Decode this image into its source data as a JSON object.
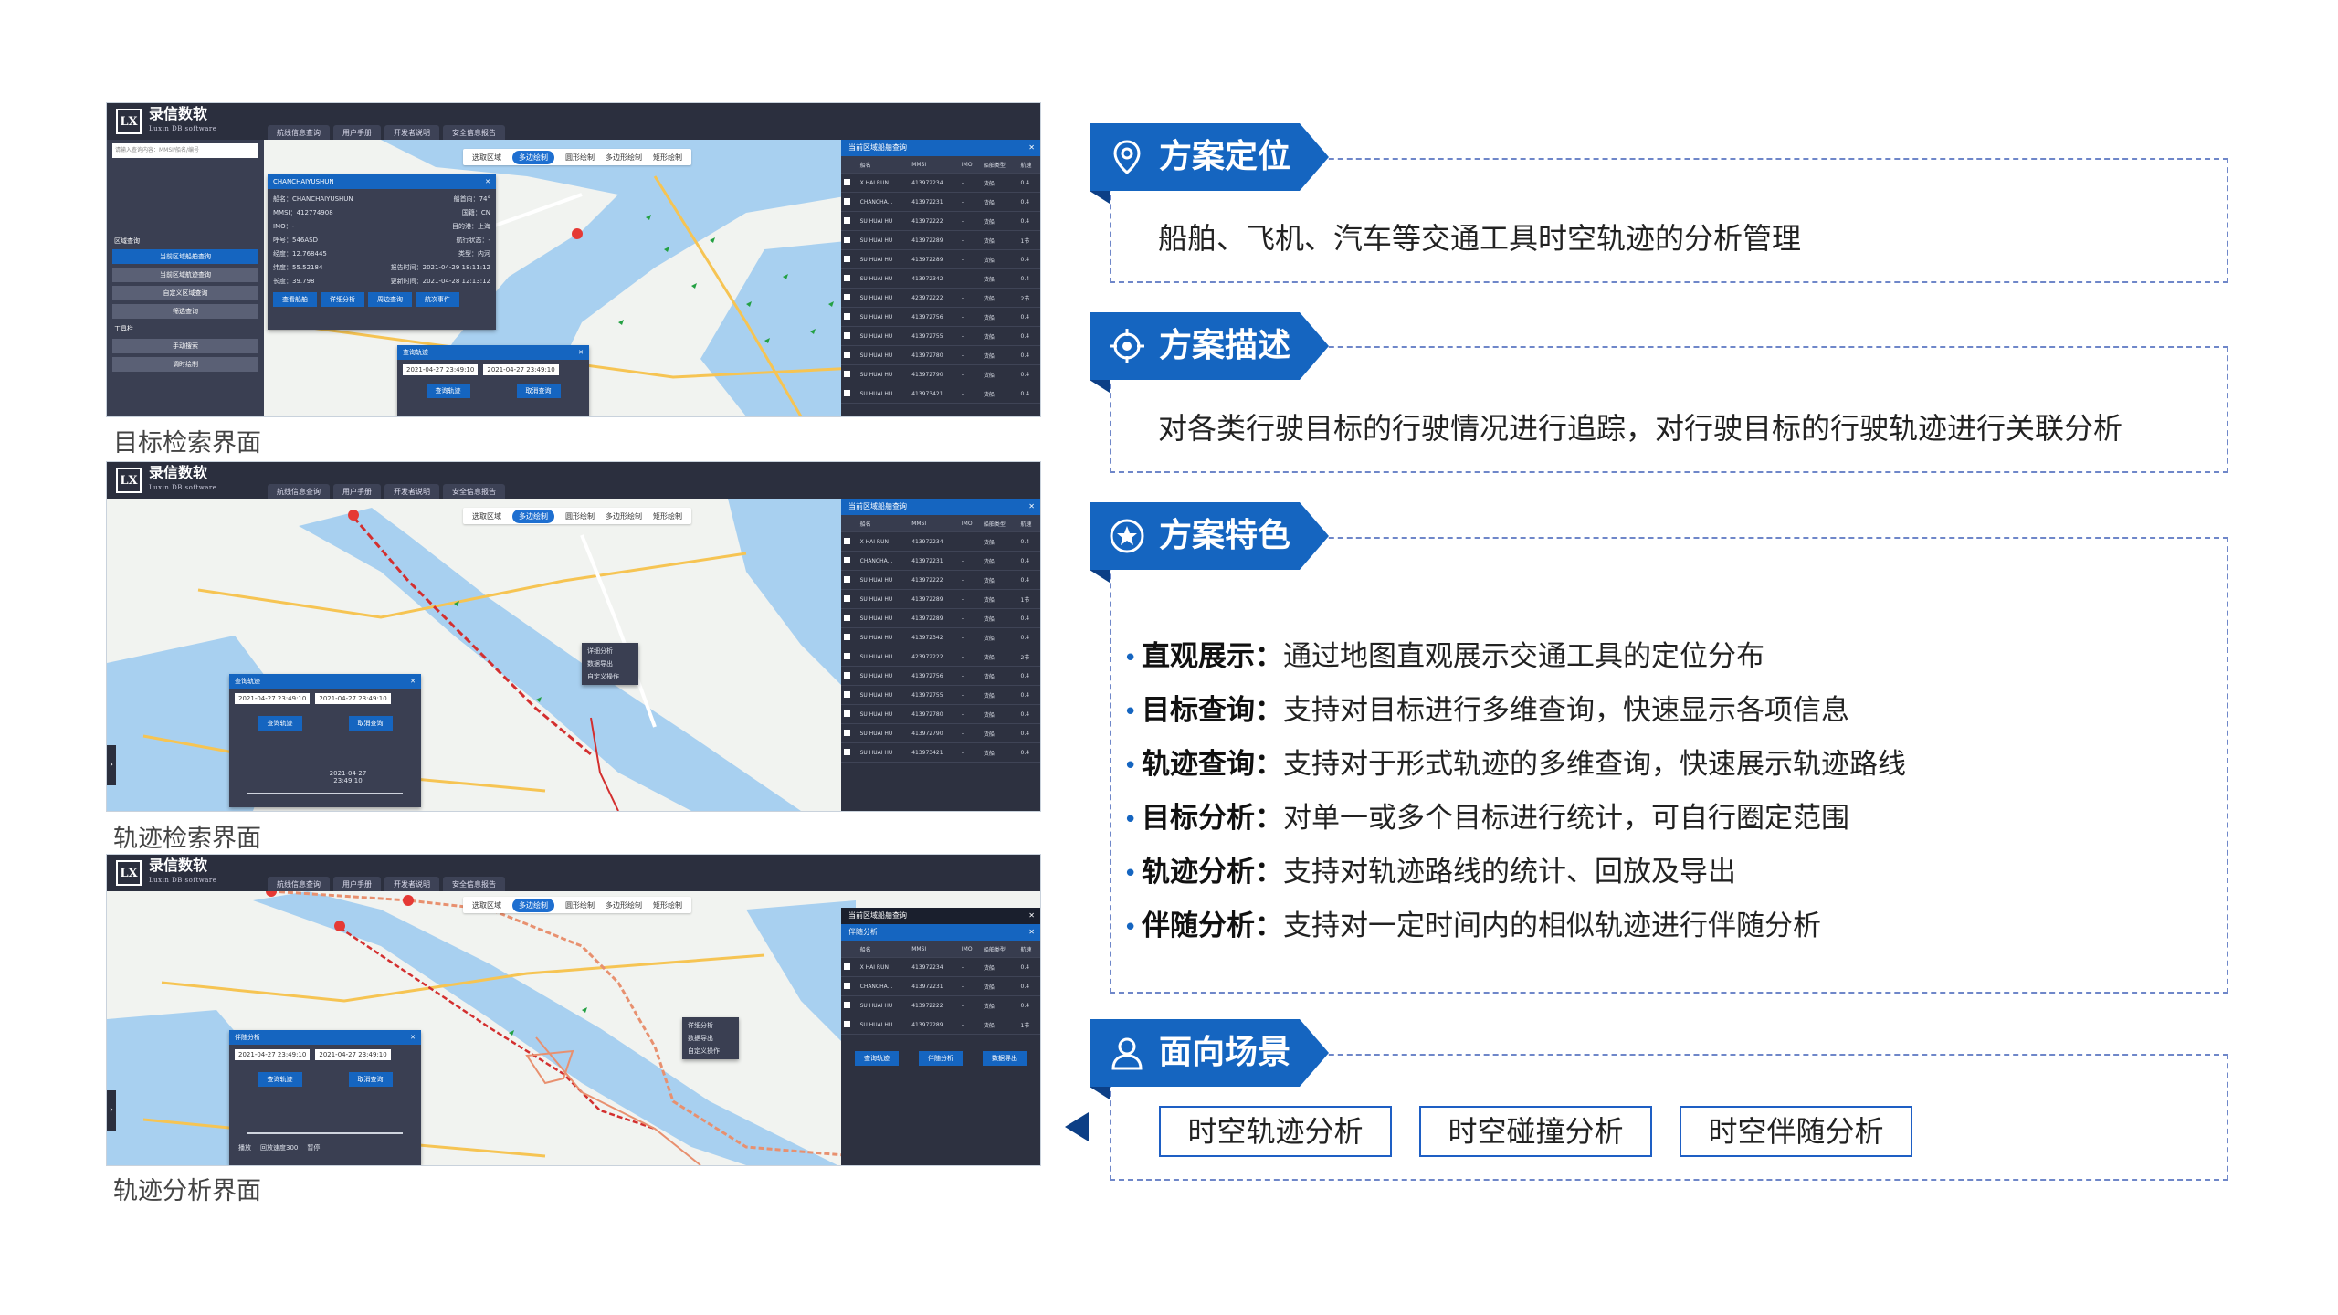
{
  "screens": [
    {
      "caption": "目标检索界面",
      "logo": "录信数软",
      "logo_sub": "Luxin DB software",
      "tabs": [
        "航线信息查询",
        "用户手册",
        "开发者说明",
        "安全信息报告"
      ],
      "search_placeholder": "请输入查询内容：MMSI/船名/编号",
      "draw_tools": [
        "选取区域",
        "多边绘制",
        "圆形绘制",
        "多边形绘制",
        "矩形绘制"
      ],
      "sidebar_buttons": [
        "当前区域船舶查询",
        "当前区域航迹查询",
        "自定义区域查询",
        "筛选查询"
      ],
      "sidebar_sections": [
        "区域查询",
        "工具栏",
        "手动搜索",
        "调时绘制"
      ],
      "popup_title": "CHANCHAIYUSHUN",
      "popup_fields": [
        [
          "船名：CHANCHAIYUSHUN",
          "船首向：74°"
        ],
        [
          "MMSI：412774908",
          "国籍：CN"
        ],
        [
          "IMO：-",
          "目的港：上海"
        ],
        [
          "呼号：546ASD",
          "航行状态：-"
        ],
        [
          "经度：12.768445",
          "类型：内河"
        ],
        [
          "纬度：55.52184",
          "报告时间：2021-04-29 18:11:12"
        ],
        [
          "长度：39.798",
          "更新时间：2021-04-28 12:13:12"
        ]
      ],
      "popup_buttons": [
        "查看船舶",
        "详细分析",
        "周边查询",
        "航次事件"
      ],
      "track_query_title": "查询轨迹",
      "time_from": "2021-04-27 23:49:10",
      "time_to": "2021-04-27 23:49:10",
      "query_buttons": [
        "查询轨迹",
        "取消查询"
      ],
      "right_panel_title": "当前区域船舶查询"
    },
    {
      "caption": "轨迹检索界面",
      "popup_time_from": "2021-04-27 23:49:10",
      "popup_time_to": "2021-04-27 23:49:10",
      "buttons": [
        "查询轨迹",
        "取消查询"
      ],
      "slider_label": "2021-04-27 23:49:10",
      "context_menu": [
        "详细分析",
        "数据导出",
        "自定义操作"
      ]
    },
    {
      "caption": "轨迹分析界面",
      "popup_title": "伴随分析",
      "popup_time_from": "2021-04-27 23:49:10",
      "popup_time_to": "2021-04-27 23:49:10",
      "buttons": [
        "查询轨迹",
        "取消查询"
      ],
      "playback": [
        "播放",
        "回放速度300",
        "暂停"
      ],
      "right_panel_title": "伴随分析",
      "right_panel_buttons": [
        "查询轨迹",
        "伴随分析",
        "数据导出"
      ],
      "context_menu": [
        "详细分析",
        "数据导出",
        "自定义操作"
      ]
    }
  ],
  "table": {
    "headers": [
      "船名",
      "MMSI",
      "IMO",
      "船舶类型",
      "航速"
    ],
    "rows": [
      [
        "X HAI RUN",
        "413972234",
        "-",
        "货船",
        "0.4"
      ],
      [
        "CHANCHA...",
        "413972231",
        "-",
        "货船",
        "0.4"
      ],
      [
        "SU HUAI HU",
        "413972222",
        "-",
        "货船",
        "0.4"
      ],
      [
        "SU HUAI HU",
        "413972289",
        "-",
        "货船",
        "1节"
      ],
      [
        "SU HUAI HU",
        "413972289",
        "-",
        "货船",
        "0.4"
      ],
      [
        "SU HUAI HU",
        "413972342",
        "-",
        "货船",
        "0.4"
      ],
      [
        "SU HUAI HU",
        "423972222",
        "-",
        "货船",
        "2节"
      ],
      [
        "SU HUAI HU",
        "413972756",
        "-",
        "货船",
        "0.4"
      ],
      [
        "SU HUAI HU",
        "413972755",
        "-",
        "货船",
        "0.4"
      ],
      [
        "SU HUAI HU",
        "413972780",
        "-",
        "货船",
        "0.4"
      ],
      [
        "SU HUAI HU",
        "413972790",
        "-",
        "货船",
        "0.4"
      ],
      [
        "SU HUAI HU",
        "413973421",
        "-",
        "货船",
        "0.4"
      ]
    ]
  },
  "sections": {
    "positioning": {
      "title": "方案定位",
      "text": "船舶、飞机、汽车等交通工具时空轨迹的分析管理"
    },
    "description": {
      "title": "方案描述",
      "text": "对各类行驶目标的行驶情况进行追踪，对行驶目标的行驶轨迹进行关联分析"
    },
    "features": {
      "title": "方案特色",
      "items": [
        {
          "label": "直观展示：",
          "text": "通过地图直观展示交通工具的定位分布"
        },
        {
          "label": "目标查询：",
          "text": "支持对目标进行多维查询，快速显示各项信息"
        },
        {
          "label": "轨迹查询：",
          "text": "支持对于形式轨迹的多维查询，快速展示轨迹路线"
        },
        {
          "label": "目标分析：",
          "text": "对单一或多个目标进行统计，可自行圈定范围"
        },
        {
          "label": "轨迹分析：",
          "text": "支持对轨迹路线的统计、回放及导出"
        },
        {
          "label": "伴随分析：",
          "text": "支持对一定时间内的相似轨迹进行伴随分析"
        }
      ]
    },
    "scenarios": {
      "title": "面向场景",
      "items": [
        "时空轨迹分析",
        "时空碰撞分析",
        "时空伴随分析"
      ]
    }
  },
  "colors": {
    "accent": "#1565c0",
    "dash": "#6f87c9",
    "dark_ui": "#2b2f3e"
  }
}
